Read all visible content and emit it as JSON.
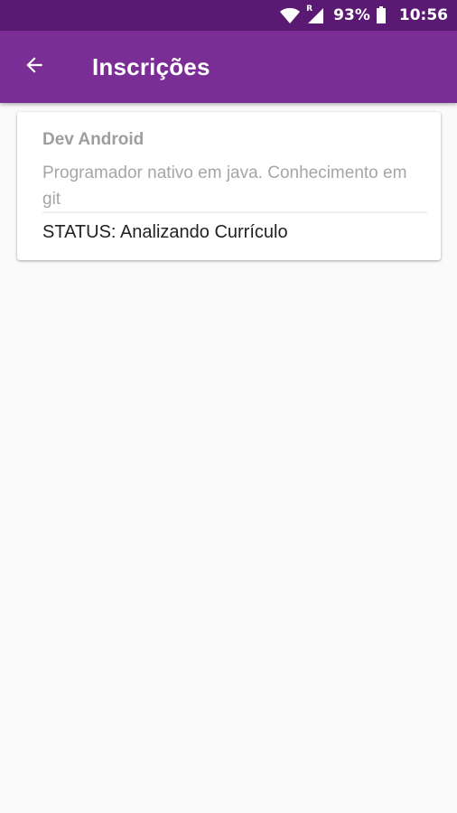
{
  "status_bar": {
    "battery_percent": "93%",
    "time": "10:56",
    "roaming_indicator": "R",
    "icons": [
      "wifi-icon",
      "signal-icon",
      "battery-icon"
    ]
  },
  "app_bar": {
    "title": "Inscrições",
    "back_icon": "arrow-back-icon",
    "color": "#7b2d96"
  },
  "subscriptions": [
    {
      "title": "Dev Android",
      "description": "Programador nativo em java. Conhecimento em git",
      "status": "STATUS: Analizando Currículo"
    }
  ]
}
